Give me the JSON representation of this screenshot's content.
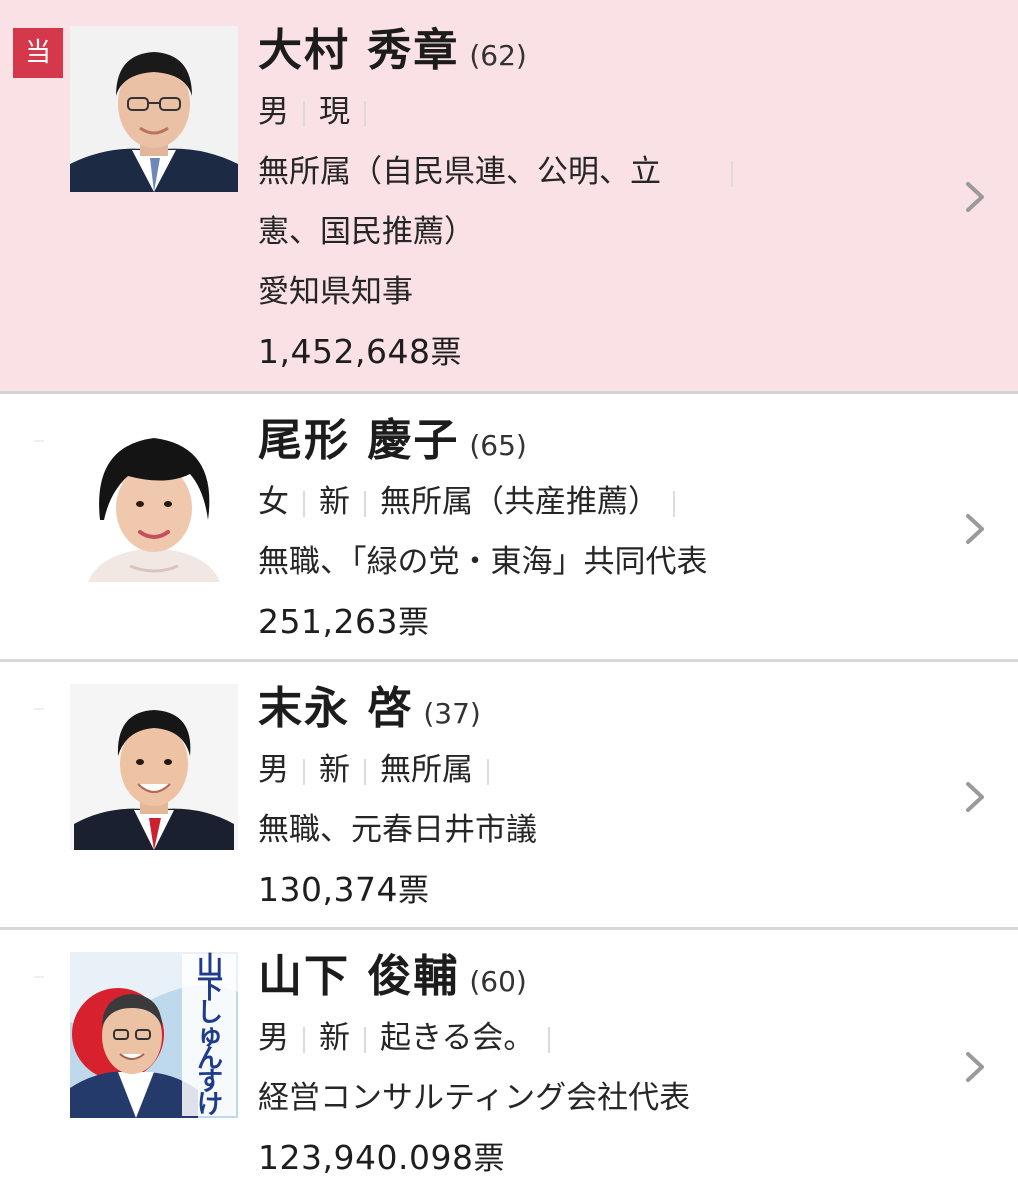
{
  "colors": {
    "winner_bg": "#f9e1e5",
    "badge": "#d6384b",
    "chevron": "#9a9a9a"
  },
  "candidates": [
    {
      "winner": true,
      "badge": "当",
      "name": "大村 秀章",
      "age": "(62)",
      "gender": "男",
      "status": "現",
      "party_line1": "無所属（自民県連、公明、立",
      "party_line2": "憲、国民推薦）",
      "occupation": "愛知県知事",
      "votes": "1,452,648",
      "votes_unit": "票",
      "photo_icon": "candidate-portrait-man-suit"
    },
    {
      "winner": false,
      "name": "尾形 慶子",
      "age": "(65)",
      "gender": "女",
      "status": "新",
      "party": "無所属（共産推薦）",
      "occupation": "無職、「緑の党・東海」共同代表",
      "votes": "251,263",
      "votes_unit": "票",
      "photo_icon": "candidate-portrait-woman"
    },
    {
      "winner": false,
      "name": "末永 啓",
      "age": "(37)",
      "gender": "男",
      "status": "新",
      "party": "無所属",
      "occupation": "無職、元春日井市議",
      "votes": "130,374",
      "votes_unit": "票",
      "photo_icon": "candidate-portrait-man-red-tie"
    },
    {
      "winner": false,
      "name": "山下 俊輔",
      "age": "(60)",
      "gender": "男",
      "status": "新",
      "party": "起きる会。",
      "occupation": "経営コンサルティング会社代表",
      "votes": "123,940.098",
      "votes_unit": "票",
      "poster_text": "山下しゅんすけ",
      "photo_icon": "candidate-campaign-poster"
    }
  ]
}
